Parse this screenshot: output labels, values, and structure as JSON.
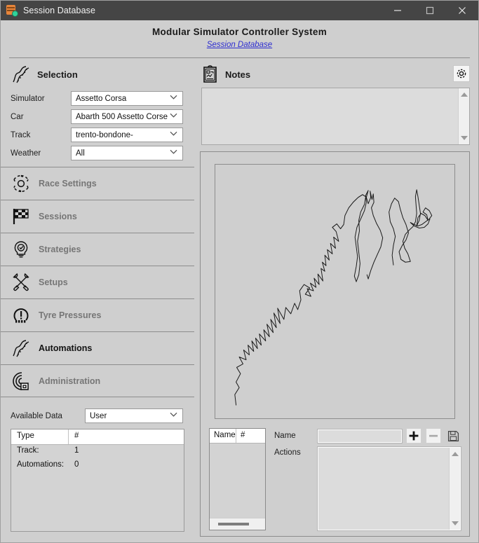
{
  "window": {
    "title": "Session Database",
    "icon": "database-gear-icon",
    "controls": {
      "minimize": "minimize-icon",
      "maximize": "maximize-icon",
      "close": "close-icon"
    }
  },
  "header": {
    "title": "Modular Simulator Controller System",
    "subtitle": "Session Database"
  },
  "selection": {
    "heading": "Selection",
    "icon": "winding-road-icon",
    "fields": [
      {
        "label": "Simulator",
        "value": "Assetto Corsa"
      },
      {
        "label": "Car",
        "value": "Abarth 500 Assetto Corse"
      },
      {
        "label": "Track",
        "value": "trento-bondone-"
      },
      {
        "label": "Weather",
        "value": "All"
      }
    ]
  },
  "nav": {
    "items": [
      {
        "label": "Race Settings",
        "icon": "gear-icon",
        "active": false
      },
      {
        "label": "Sessions",
        "icon": "checkered-flag-icon",
        "active": false
      },
      {
        "label": "Strategies",
        "icon": "lightbulb-target-icon",
        "active": false
      },
      {
        "label": "Setups",
        "icon": "tools-icon",
        "active": false
      },
      {
        "label": "Tyre Pressures",
        "icon": "tyre-warning-icon",
        "active": false
      },
      {
        "label": "Automations",
        "icon": "winding-road-icon",
        "active": true
      },
      {
        "label": "Administration",
        "icon": "radar-icon",
        "active": false
      }
    ]
  },
  "available_data": {
    "label": "Available Data",
    "scope": "User",
    "columns": [
      "Type",
      "#"
    ],
    "rows": [
      {
        "type": "Track:",
        "count": "1"
      },
      {
        "type": "Automations:",
        "count": "0"
      }
    ]
  },
  "notes": {
    "heading": "Notes",
    "icon": "clipboard-notes-icon",
    "value": "",
    "settings_icon": "gear-icon"
  },
  "map": {
    "track": "trento-bondone-"
  },
  "automations": {
    "table": {
      "columns": [
        "Name",
        "#"
      ],
      "rows": []
    },
    "name_label": "Name",
    "name_value": "",
    "actions_label": "Actions",
    "actions_value": "",
    "buttons": {
      "add": "plus-icon",
      "remove": "minus-icon",
      "save": "floppy-save-icon"
    }
  },
  "colors": {
    "background": "#cfcfcf",
    "titlebar": "#454545",
    "link": "#2b2bd0",
    "accent_icon_orange": "#e8853a",
    "accent_icon_green": "#2fd39b",
    "nav_inactive": "#767676",
    "nav_active": "#141414"
  }
}
